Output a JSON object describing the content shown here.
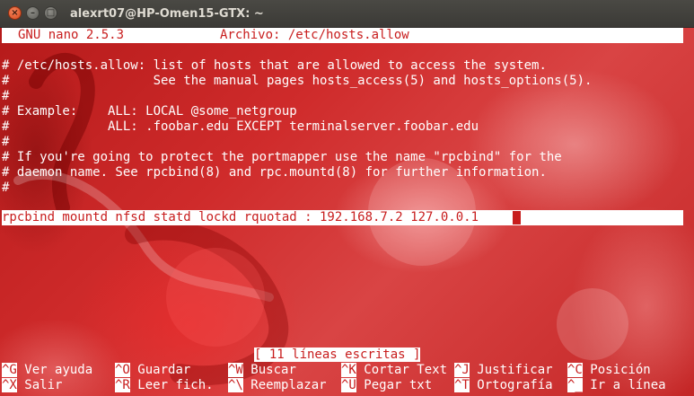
{
  "window": {
    "title": "alexrt07@HP-Omen15-GTX: ~",
    "close_glyph": "×",
    "minimize_glyph": "–",
    "maximize_glyph": "□"
  },
  "nano": {
    "version_label": "GNU nano 2.5.3",
    "file_label": "Archivo: /etc/hosts.allow"
  },
  "file_lines": [
    "",
    "# /etc/hosts.allow: list of hosts that are allowed to access the system.",
    "#                   See the manual pages hosts_access(5) and hosts_options(5).",
    "#",
    "# Example:    ALL: LOCAL @some_netgroup",
    "#             ALL: .foobar.edu EXCEPT terminalserver.foobar.edu",
    "#",
    "# If you're going to protect the portmapper use the name \"rpcbind\" for the",
    "# daemon name. See rpcbind(8) and rpc.mountd(8) for further information.",
    "#",
    "",
    "rpcbind mountd nfsd statd lockd rquotad : 192.168.7.2 127.0.0.1"
  ],
  "status_message": "[ 11 líneas escritas ]",
  "shortcuts": {
    "row1": [
      {
        "key": "^G",
        "label": "Ver ayuda"
      },
      {
        "key": "^O",
        "label": "Guardar"
      },
      {
        "key": "^W",
        "label": "Buscar"
      },
      {
        "key": "^K",
        "label": "Cortar Text"
      },
      {
        "key": "^J",
        "label": "Justificar"
      },
      {
        "key": "^C",
        "label": "Posición"
      }
    ],
    "row2": [
      {
        "key": "^X",
        "label": "Salir"
      },
      {
        "key": "^R",
        "label": "Leer fich."
      },
      {
        "key": "^\\",
        "label": "Reemplazar"
      },
      {
        "key": "^U",
        "label": "Pegar txt"
      },
      {
        "key": "^T",
        "label": "Ortografía"
      },
      {
        "key": "^_",
        "label": "Ir a línea"
      }
    ]
  },
  "colors": {
    "terminal_background": "#c81d1d",
    "text": "#ffffff",
    "reverse_text": "#c81d1d"
  }
}
